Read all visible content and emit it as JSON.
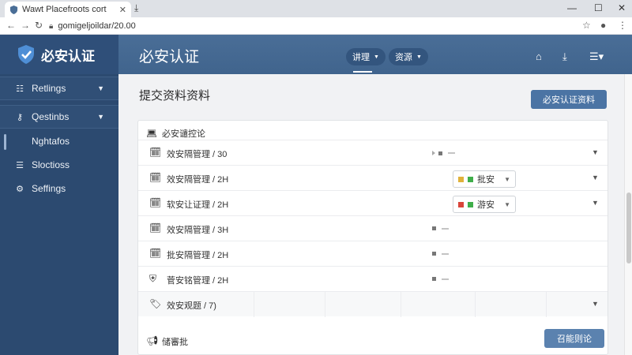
{
  "browser": {
    "tab_title": "Wawt Placefroots cort",
    "url": "gomigeljoildar/20.00"
  },
  "header": {
    "brand_name": "必安认证",
    "title": "必安认证",
    "menus": [
      {
        "label": "讲理"
      },
      {
        "label": "资源"
      }
    ],
    "icons": [
      "home-icon",
      "download-icon",
      "list-menu-icon"
    ]
  },
  "sidebar": {
    "items": [
      {
        "label": "Retlings",
        "icon": "list-icon",
        "has_chevron": true,
        "boxed": true
      },
      {
        "label": "Qestinbs",
        "icon": "key-icon",
        "has_chevron": true,
        "boxed": true
      },
      {
        "label": "Nghtafos",
        "icon": "bar-icon",
        "has_chevron": false,
        "boxed": false
      },
      {
        "label": "Sloctioss",
        "icon": "sliders-icon",
        "has_chevron": false,
        "boxed": false
      },
      {
        "label": "Seffings",
        "icon": "gear-icon",
        "has_chevron": false,
        "boxed": false
      }
    ]
  },
  "main": {
    "page_title": "提交资料资料",
    "primary_button": "必安认证资料",
    "card": {
      "header_label": "必安谴控论",
      "rows": [
        {
          "label": "效安隔管理 / 30",
          "icon": "calendar-icon",
          "status": null
        },
        {
          "label": "效安隔管理 / 2H",
          "icon": "calendar-icon",
          "status": {
            "text": "批安",
            "colors": [
              "#e0b23a",
              "#3fae4a"
            ]
          }
        },
        {
          "label": "软安让证理 / 2H",
          "icon": "calendar-icon",
          "status": {
            "text": "游安",
            "colors": [
              "#d9453a",
              "#3fae4a"
            ]
          }
        },
        {
          "label": "效安隔管理 / 3H",
          "icon": "calendar-icon",
          "status": null
        },
        {
          "label": "批安隔管理 / 2H",
          "icon": "calendar-icon",
          "status": null
        },
        {
          "label": "菅安铭管理 / 2H",
          "icon": "shield-icon",
          "status": null
        },
        {
          "label": "效安观题 / 7)",
          "icon": "tag-icon",
          "status": null
        }
      ],
      "footer_label": "储審批",
      "footer_button": "召能则论"
    }
  }
}
